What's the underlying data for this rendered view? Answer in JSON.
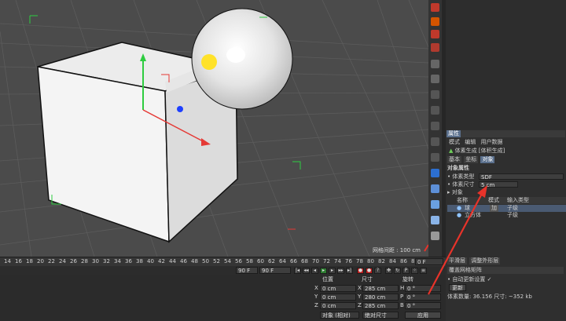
{
  "viewport": {
    "grid_spacing": "网格间距 : 100 cm"
  },
  "attributes": {
    "header_tab": "属性",
    "menu": [
      "模式",
      "编辑",
      "用户数据"
    ],
    "object_title": "体素生成 [体积生成]",
    "tabs": [
      "基本",
      "坐标",
      "对象"
    ],
    "section_title": "对象属性",
    "voxel_type_label": "体素类型",
    "voxel_type_value": "SDF",
    "voxel_size_label": "体素尺寸",
    "voxel_size_value": "5 cm",
    "objects_label": "对象",
    "table_headers": [
      "名称",
      "模式",
      "输入类型"
    ],
    "rows": [
      {
        "name": "球",
        "mode": "加",
        "input": "子级"
      },
      {
        "name": "立方体",
        "mode": "",
        "input": "子级"
      }
    ]
  },
  "lower_panel": {
    "tabs": [
      "平滑层",
      "调整外形层"
    ],
    "filter_label": "覆盖网格矩阵",
    "auto_update_label": "自动更新设置",
    "update_button": "更新",
    "stats": "体素数量: 36.156 尺寸: ~352 kb"
  },
  "timeline": {
    "ticks": [
      "14",
      "16",
      "18",
      "20",
      "22",
      "24",
      "26",
      "28",
      "30",
      "32",
      "34",
      "36",
      "38",
      "40",
      "42",
      "44",
      "46",
      "48",
      "50",
      "52",
      "54",
      "56",
      "58",
      "60",
      "62",
      "64",
      "66",
      "68",
      "70",
      "72",
      "74",
      "76",
      "78",
      "80",
      "82",
      "84",
      "86",
      "88",
      "90"
    ],
    "current_frame": "0 F",
    "end_frame_a": "90 F",
    "end_frame_b": "90 F"
  },
  "coords": {
    "headers": [
      "位置",
      "尺寸",
      "旋转"
    ],
    "rows": [
      {
        "axis": "X",
        "pos": "0 cm",
        "size_axis": "X",
        "size": "285 cm",
        "rot_axis": "H",
        "rot": "0 °"
      },
      {
        "axis": "Y",
        "pos": "0 cm",
        "size_axis": "Y",
        "size": "280 cm",
        "rot_axis": "P",
        "rot": "0 °"
      },
      {
        "axis": "Z",
        "pos": "0 cm",
        "size_axis": "Z",
        "size": "285 cm",
        "rot_axis": "B",
        "rot": "0 °"
      }
    ],
    "mode_select": "对象 (相对)",
    "size_select": "绝对尺寸",
    "apply_button": "应用"
  },
  "colors": {
    "accent": "#5a6f8c",
    "annotation": "#e8332a",
    "selection": "#ffd200"
  }
}
